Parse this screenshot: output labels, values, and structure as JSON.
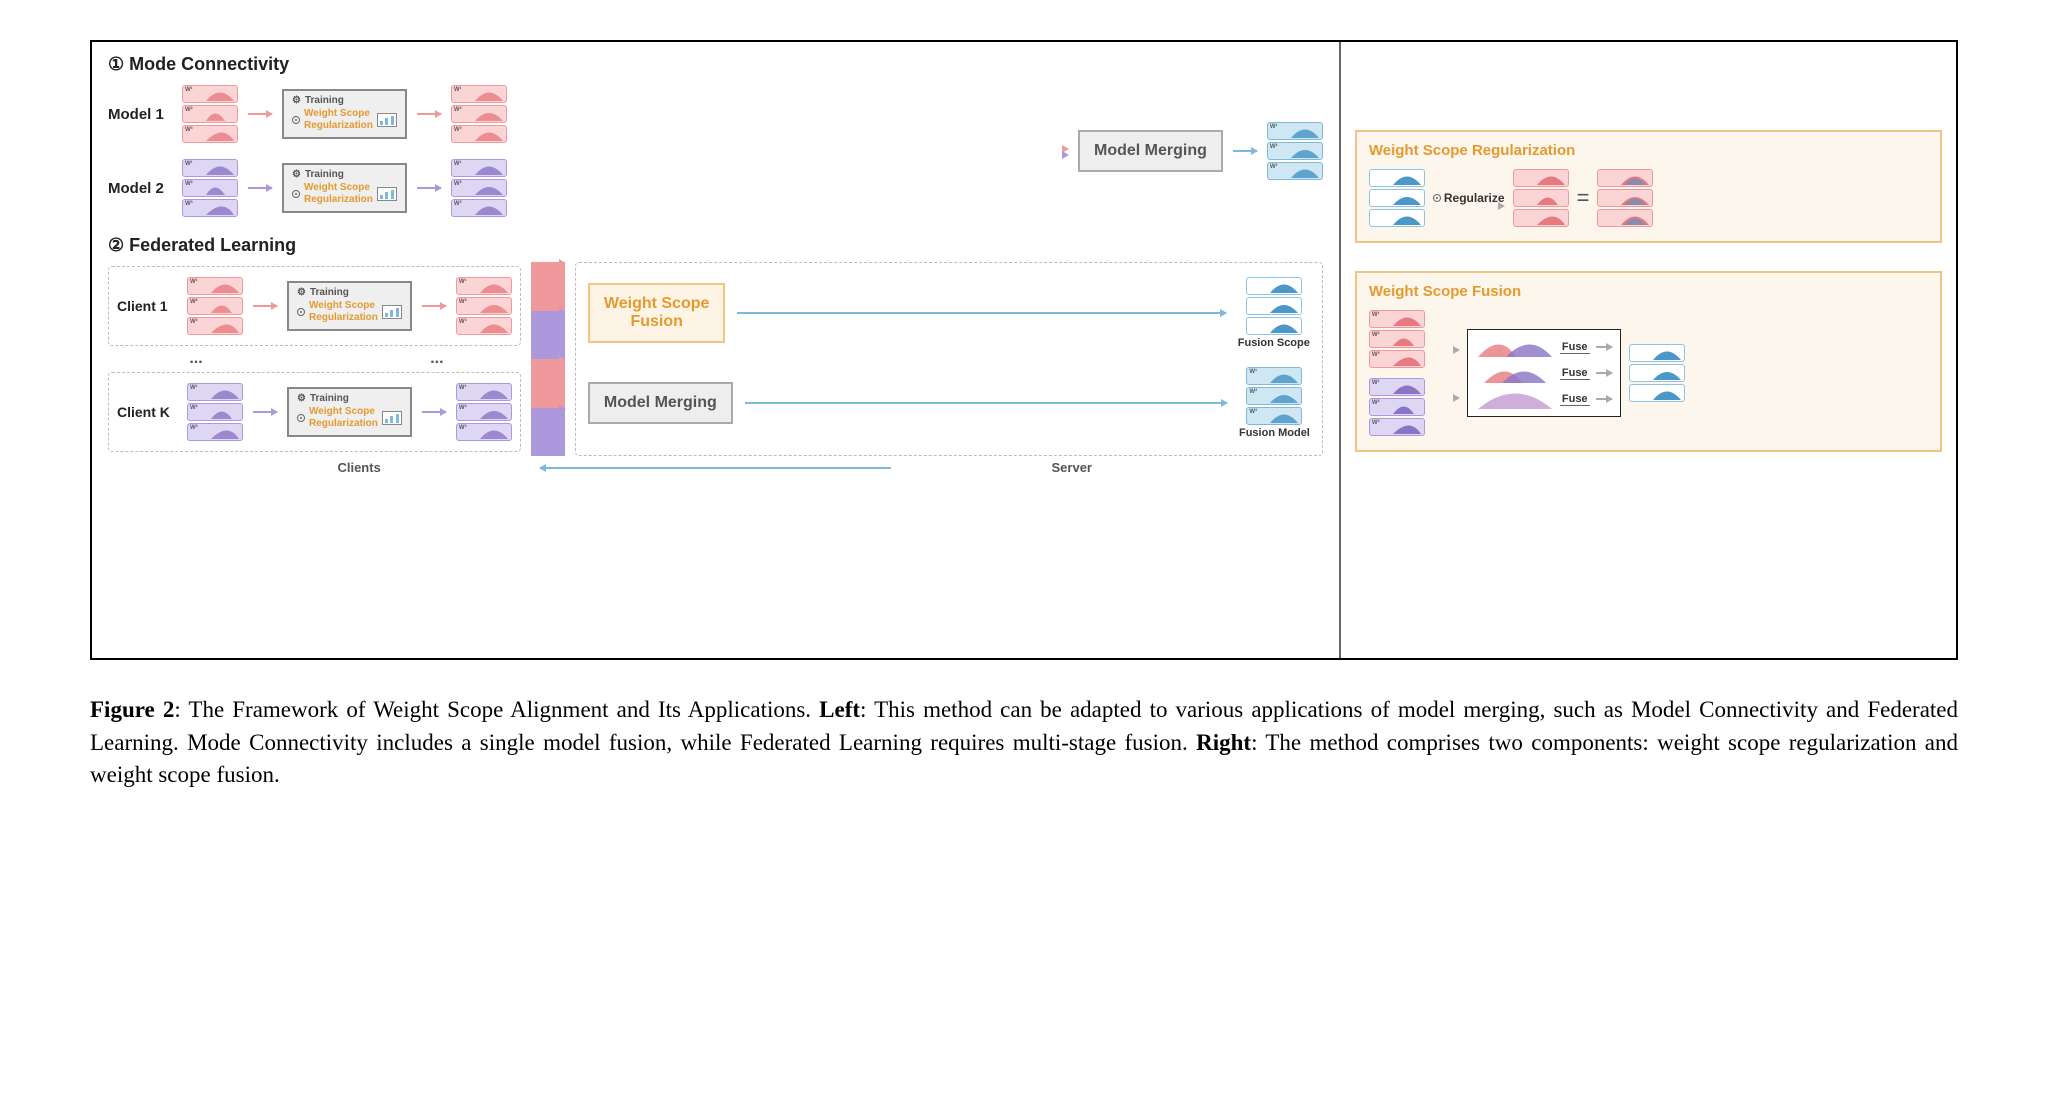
{
  "figure": {
    "section1_title": "① Mode Connectivity",
    "section2_title": "② Federated Learning",
    "labels": {
      "model1": "Model 1",
      "model2": "Model 2",
      "client1": "Client 1",
      "clientK": "Client K",
      "clients": "Clients",
      "server": "Server",
      "dots": "..."
    },
    "boxes": {
      "training": "Training",
      "wsr": "Weight Scope\nRegularization",
      "model_merging": "Model Merging",
      "wsf": "Weight Scope\nFusion"
    },
    "fusion_labels": {
      "scope": "Fusion Scope",
      "model": "Fusion Model"
    },
    "layer_tags": [
      "W¹",
      "W²",
      "W³"
    ]
  },
  "right": {
    "card1_title": "Weight Scope Regularization",
    "regularize": "Regularize",
    "card2_title": "Weight Scope Fusion",
    "fuse": "Fuse"
  },
  "caption": {
    "fig_label": "Figure 2",
    "text_before_left": ": The Framework of Weight Scope Alignment and Its Applications. ",
    "left_word": "Left",
    "text_mid": ": This method can be adapted to various applications of model merging, such as Model Connectivity and Federated Learning. Mode Connectivity includes a single model fusion, while Federated Learning requires multi-stage fusion. ",
    "right_word": "Right",
    "text_after": ": The method comprises two components: weight scope regularization and weight scope fusion."
  }
}
